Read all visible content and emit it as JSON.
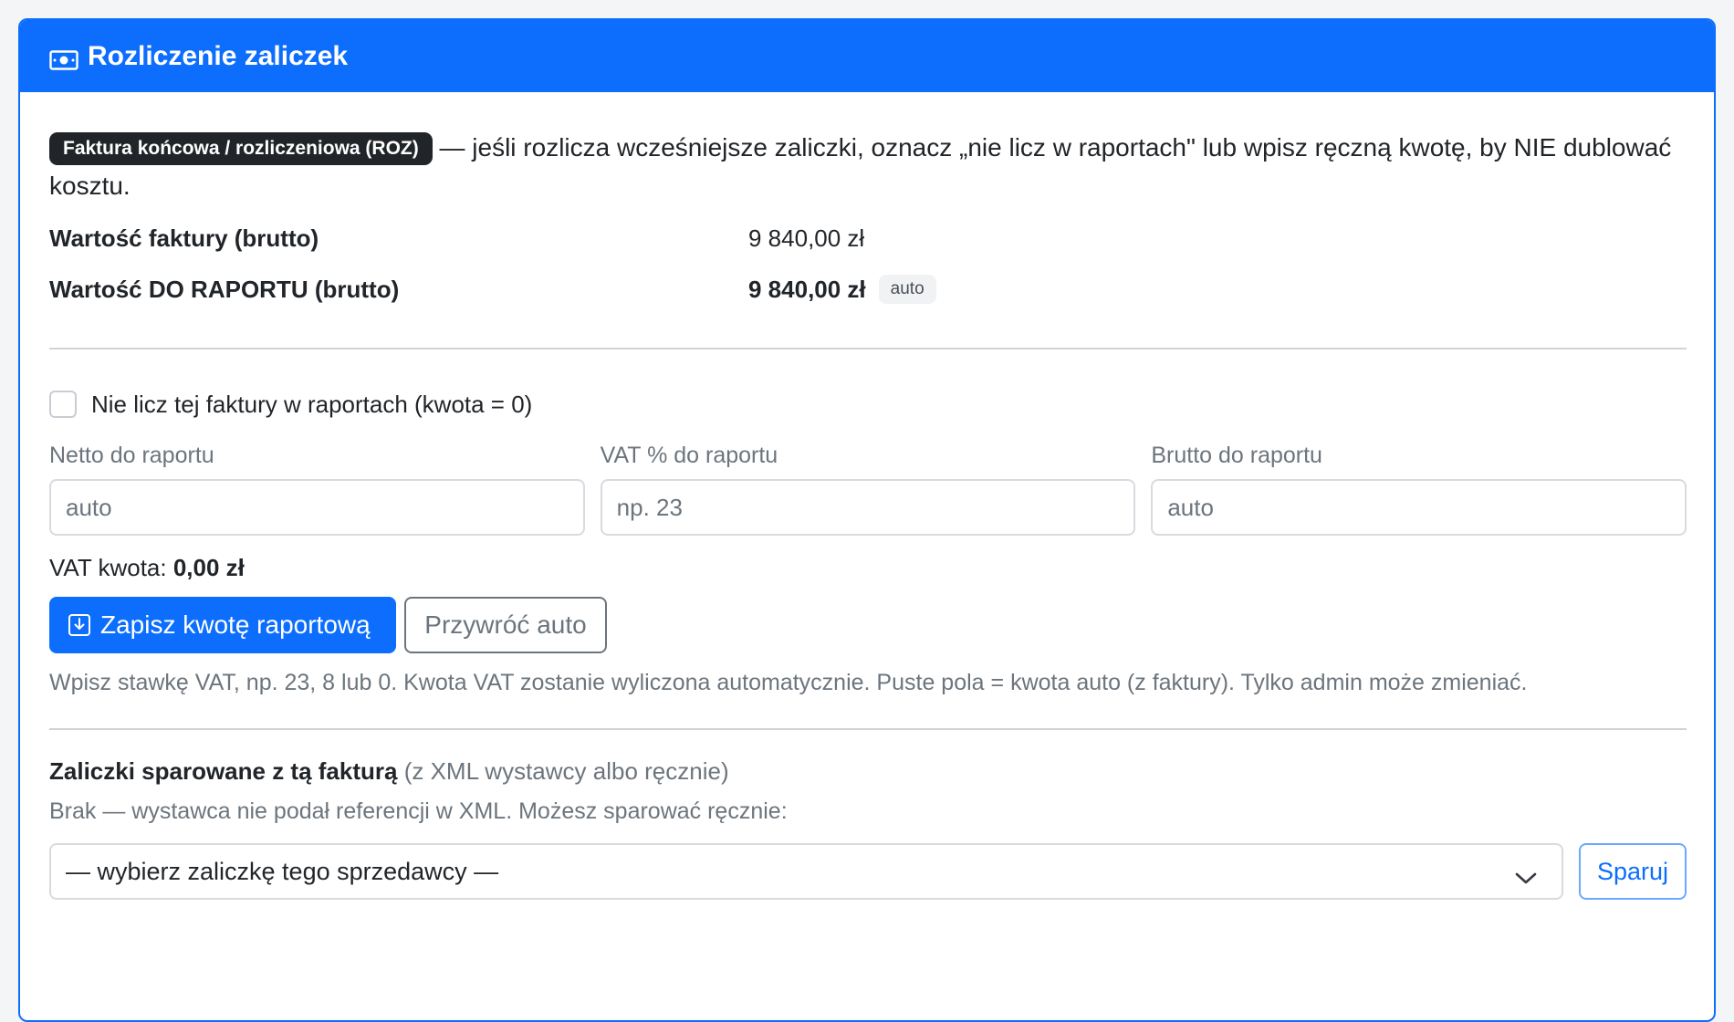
{
  "header": {
    "title": "Rozliczenie zaliczek",
    "icon": "cash-icon"
  },
  "intro": {
    "badge": "Faktura końcowa / rozliczeniowa (ROZ)",
    "text": " — jeśli rozlicza wcześniejsze zaliczki, oznacz „nie licz w raportach\" lub wpisz ręczną kwotę, by NIE dublować kosztu."
  },
  "summary": {
    "invoice_label": "Wartość faktury (brutto)",
    "invoice_value": "9 840,00 zł",
    "report_label": "Wartość DO RAPORTU (brutto)",
    "report_value": "9 840,00 zł",
    "report_badge": "auto"
  },
  "exclude_checkbox": {
    "label": "Nie licz tej faktury w raportach (kwota = 0)",
    "checked": false
  },
  "fields": {
    "netto_label": "Netto do raportu",
    "netto_placeholder": "auto",
    "vat_label": "VAT % do raportu",
    "vat_placeholder": "np. 23",
    "brutto_label": "Brutto do raportu",
    "brutto_placeholder": "auto"
  },
  "vat_amount": {
    "label": "VAT kwota:",
    "value": "0,00 zł"
  },
  "buttons": {
    "save": "Zapisz kwotę raportową",
    "restore": "Przywróć auto"
  },
  "help_text": "Wpisz stawkę VAT, np. 23, 8 lub 0. Kwota VAT zostanie wyliczona automatycznie. Puste pola = kwota auto (z faktury). Tylko admin może zmieniać.",
  "paired": {
    "title": "Zaliczki sparowane z tą fakturą",
    "subtitle": "(z XML wystawcy albo ręcznie)",
    "info": "Brak — wystawca nie podał referencji w XML. Możesz sparować ręcznie:",
    "select_value": "— wybierz zaliczkę tego sprzedawcy —",
    "pair_button": "Sparuj"
  },
  "colors": {
    "primary": "#0d6efd",
    "dark_badge": "#212529",
    "muted": "#6c757d"
  }
}
